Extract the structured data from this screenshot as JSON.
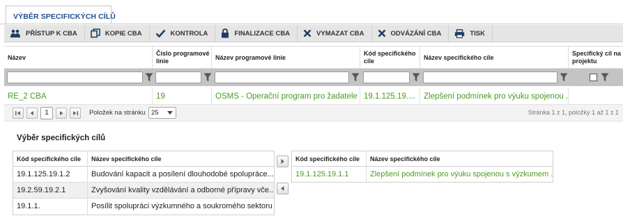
{
  "tab": {
    "label": "VÝBĚR SPECIFICKÝCH CÍLŮ"
  },
  "toolbar": {
    "buttons": [
      {
        "label": "PŘÍSTUP K CBA",
        "icon": "users-icon"
      },
      {
        "label": "KOPIE CBA",
        "icon": "copy-icon"
      },
      {
        "label": "KONTROLA",
        "icon": "check-icon"
      },
      {
        "label": "FINALIZACE CBA",
        "icon": "lock-icon"
      },
      {
        "label": "VYMAZAT CBA",
        "icon": "x-icon"
      },
      {
        "label": "ODVÁZÁNÍ CBA",
        "icon": "x-icon"
      },
      {
        "label": "TISK",
        "icon": "printer-icon"
      }
    ]
  },
  "grid": {
    "headers": [
      "Název",
      "Číslo programové linie",
      "Název programové linie",
      "Kód specifického cíle",
      "Název specifického cíle",
      "Specifický cíl na projektu"
    ],
    "rows": [
      {
        "name": "RE_2 CBA",
        "line_number": "19",
        "line_name": "OSMS - Operační program pro žadatele",
        "goal_code": "19.1.125.19....",
        "goal_name": "Zlepšení podmínek pro výuku spojenou ..."
      }
    ]
  },
  "pager": {
    "current_page": "1",
    "per_page_label": "Položek na stránku",
    "per_page_value": "25",
    "status": "Stránka 1 z 1, položky 1 až 1 z 1"
  },
  "section": {
    "title": "Výběr specifických cílů"
  },
  "available": {
    "headers": [
      "Kód specifického cíle",
      "Název specifického cíle"
    ],
    "rows": [
      {
        "code": "19.1.125.19.1.2",
        "name": "Budování kapacit a posílení dlouhodobé spolupráce..."
      },
      {
        "code": "19.2.59.19.2.1",
        "name": "Zvyšování kvality vzdělávání a odborné přípravy vče..."
      },
      {
        "code": "19.1.1.",
        "name": "Posílit spolupráci výzkumného a soukromého sektoru"
      }
    ]
  },
  "selected": {
    "headers": [
      "Kód specifického cíle",
      "Název specifického cíle"
    ],
    "rows": [
      {
        "code": "19.1.125.19.1.1",
        "name": "Zlepšení podmínek pro výuku spojenou s výzkumem ..."
      }
    ]
  },
  "colors": {
    "accent": "#1f4e8c",
    "link_green": "#4a9a23",
    "filter_bar": "#c4c4c4"
  }
}
